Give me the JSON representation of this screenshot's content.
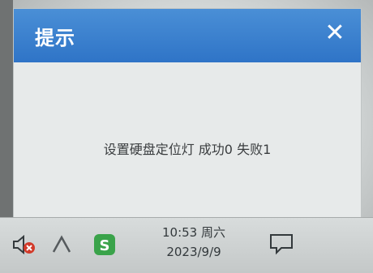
{
  "dialog": {
    "title": "提示",
    "close_label": "✕",
    "message": "设置硬盘定位灯 成功0 失败1"
  },
  "taskbar": {
    "time": "10:53 周六",
    "date": "2023/9/9",
    "icons": [
      "speaker-muted-icon",
      "caret-up-icon",
      "app-s-icon",
      "notification-icon"
    ]
  },
  "colors": {
    "titlebar": "#2f74c7",
    "dialog_bg": "#e7eaea",
    "taskbar_bg": "#d0d4d4",
    "app_s_green": "#3aa34a",
    "mute_red": "#d23a2a"
  }
}
